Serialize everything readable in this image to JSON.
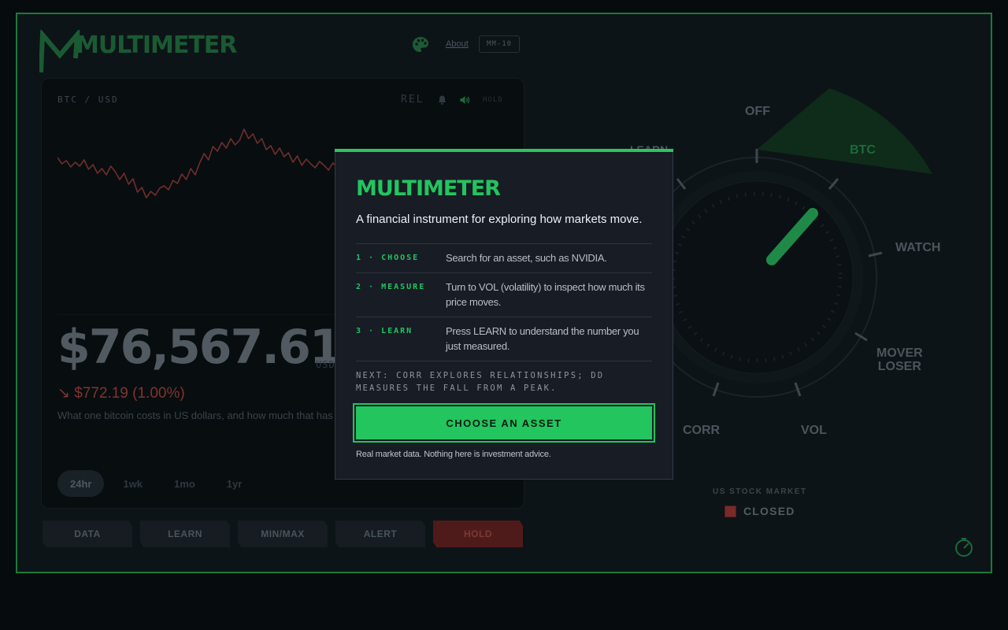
{
  "header": {
    "logo_text": "MULTIMETER",
    "about_label": "About",
    "model_label": "MM-10",
    "icons": {
      "palette": "palette-icon"
    }
  },
  "chart_panel": {
    "pair": "BTC / USD",
    "rel_label": "REL",
    "hold_tag": "HOLD",
    "price": "$76,567.61",
    "unit": "USD",
    "change": "↘ $772.19 (1.00%)",
    "description": "What one bitcoin costs in US dollars, and how much that has changed",
    "ranges": [
      "24hr",
      "1wk",
      "1mo",
      "1yr"
    ],
    "active_range": "24hr",
    "icons": {
      "alert": "bell-icon",
      "sound": "speaker-icon"
    }
  },
  "chart_data": {
    "type": "line",
    "series": [
      {
        "values": [
          0.58,
          0.5,
          0.54,
          0.46,
          0.52,
          0.47,
          0.55,
          0.43,
          0.49,
          0.38,
          0.44,
          0.36,
          0.47,
          0.4,
          0.3,
          0.38,
          0.24,
          0.31,
          0.14,
          0.2,
          0.07,
          0.15,
          0.1,
          0.19,
          0.22,
          0.17,
          0.29,
          0.25,
          0.37,
          0.3,
          0.44,
          0.36,
          0.51,
          0.63,
          0.55,
          0.72,
          0.66,
          0.77,
          0.7,
          0.82,
          0.74,
          0.8,
          0.94,
          0.82,
          0.88,
          0.76,
          0.82,
          0.68,
          0.73,
          0.62,
          0.7,
          0.59,
          0.64,
          0.52,
          0.6,
          0.48,
          0.56,
          0.5,
          0.45,
          0.53,
          0.48,
          0.42,
          0.51,
          0.46,
          0.54,
          0.45,
          0.4,
          0.47,
          0.43,
          0.52,
          0.45,
          0.55,
          0.47,
          0.42,
          0.53,
          0.46,
          0.38,
          0.44,
          0.4
        ],
        "color": "#6f2f2b"
      }
    ],
    "grid": false
  },
  "buttons": [
    "DATA",
    "LEARN",
    "MIN/MAX",
    "ALERT",
    "HOLD"
  ],
  "dial": {
    "labels": {
      "off": "OFF",
      "btc": "BTC",
      "watch": "WATCH",
      "mover_1": "MOVER",
      "mover_2": "LOSER",
      "vol": "VOL",
      "corr": "CORR",
      "learn": "LEARN"
    },
    "selected": "BTC",
    "accent": "#22c55e"
  },
  "market": {
    "label": "US STOCK MARKET",
    "status": "CLOSED",
    "status_color": "#7c2a28",
    "icons": {
      "corner": "gauge-icon"
    }
  },
  "modal": {
    "title": "MULTIMETER",
    "subtitle": "A financial instrument for exploring how markets move.",
    "steps": [
      {
        "key": "1 · CHOOSE",
        "text": "Search for an asset, such as NVIDIA."
      },
      {
        "key": "2 · MEASURE",
        "text": "Turn to VOL (volatility) to inspect how much its price moves."
      },
      {
        "key": "3 · LEARN",
        "text": "Press LEARN to understand the number you just measured."
      }
    ],
    "next": "NEXT: CORR EXPLORES RELATIONSHIPS; DD MEASURES THE FALL FROM A PEAK.",
    "cta": "CHOOSE AN ASSET",
    "footer": "Real market data. Nothing here is investment advice.",
    "accent": "#22c55e"
  }
}
